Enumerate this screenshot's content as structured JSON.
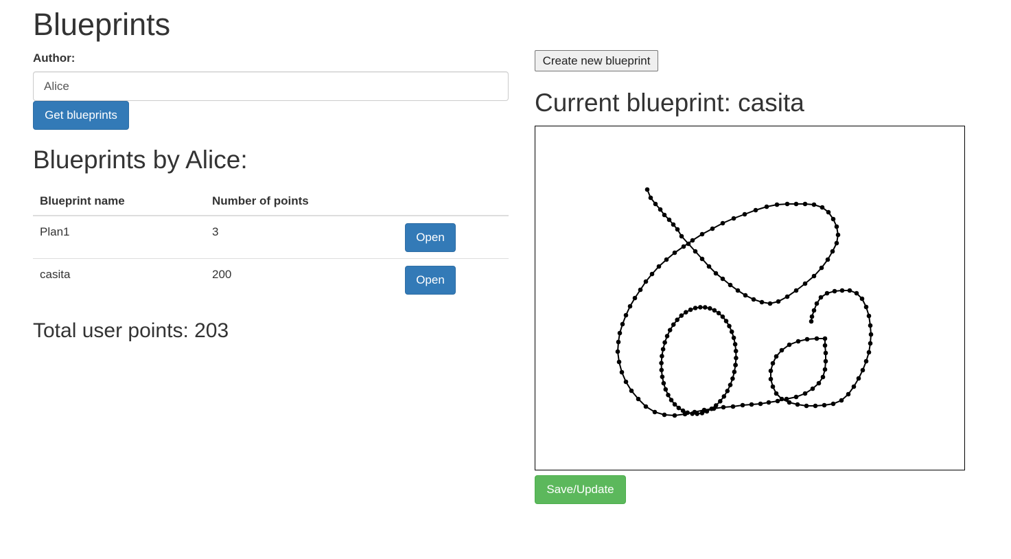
{
  "page": {
    "title": "Blueprints"
  },
  "author": {
    "label": "Author:",
    "value": "Alice"
  },
  "buttons": {
    "get_blueprints": "Get blueprints",
    "create_new": "Create new blueprint",
    "save_update": "Save/Update",
    "open": "Open"
  },
  "list": {
    "heading": "Blueprints by Alice:",
    "columns": [
      "Blueprint name",
      "Number of points",
      ""
    ],
    "rows": [
      {
        "name": "Plan1",
        "points": "3"
      },
      {
        "name": "casita",
        "points": "200"
      }
    ],
    "total": "Total user points: 203"
  },
  "current": {
    "heading": "Current blueprint: casita"
  },
  "colors": {
    "primary": "#337ab7",
    "success": "#5cb85c",
    "stroke": "#000000"
  }
}
